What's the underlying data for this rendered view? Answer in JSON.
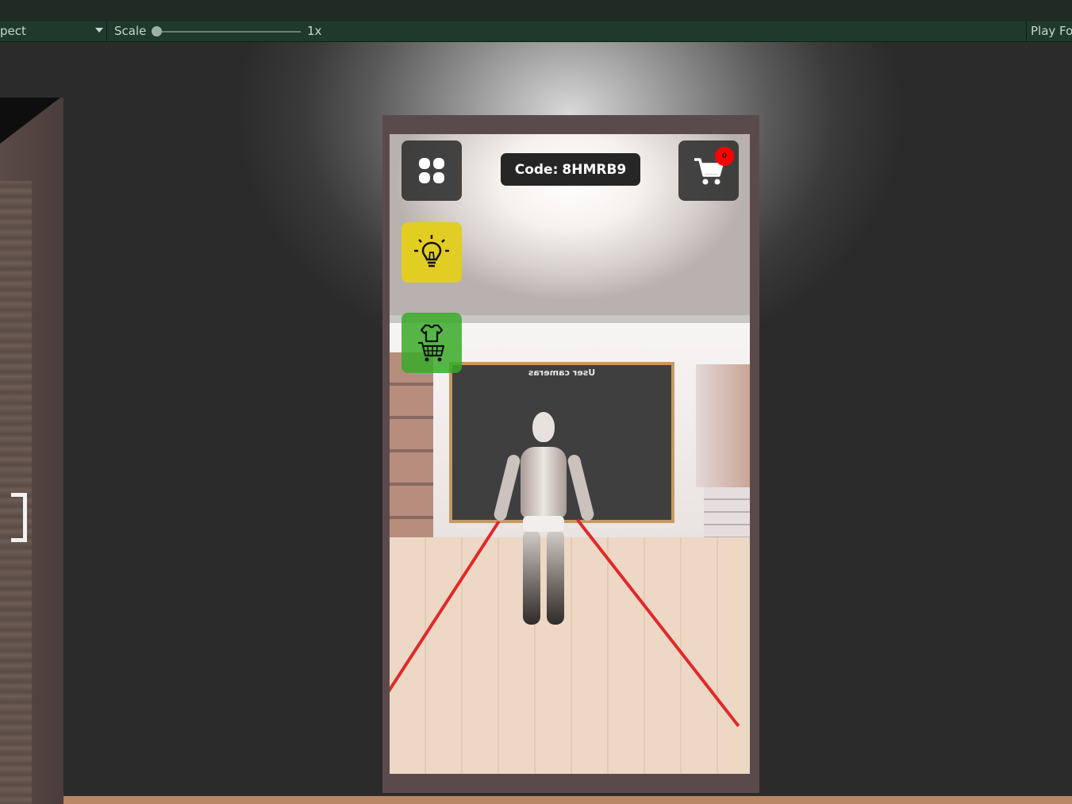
{
  "editor": {
    "aspect_label": "pect",
    "scale_label": "Scale",
    "scale_value": "1x",
    "play_focus_label": "Play Fo"
  },
  "game_ui": {
    "code_label": "Code:",
    "code_value": "8HMRB9",
    "cart_count": "0",
    "board_text": "User cameras",
    "buttons": {
      "menu_icon": "grid-four-icon",
      "idea_icon": "lightbulb-icon",
      "shop_icon": "shirt-cart-icon",
      "cart_icon": "shopping-cart-icon"
    }
  },
  "colors": {
    "editor_toolbar": "#1f3a2c",
    "idea_button": "#e2cd22",
    "shop_button": "#38aa28",
    "dark_button": "#2d2d2d",
    "badge": "#ff0000",
    "laser": "#e0282a"
  }
}
